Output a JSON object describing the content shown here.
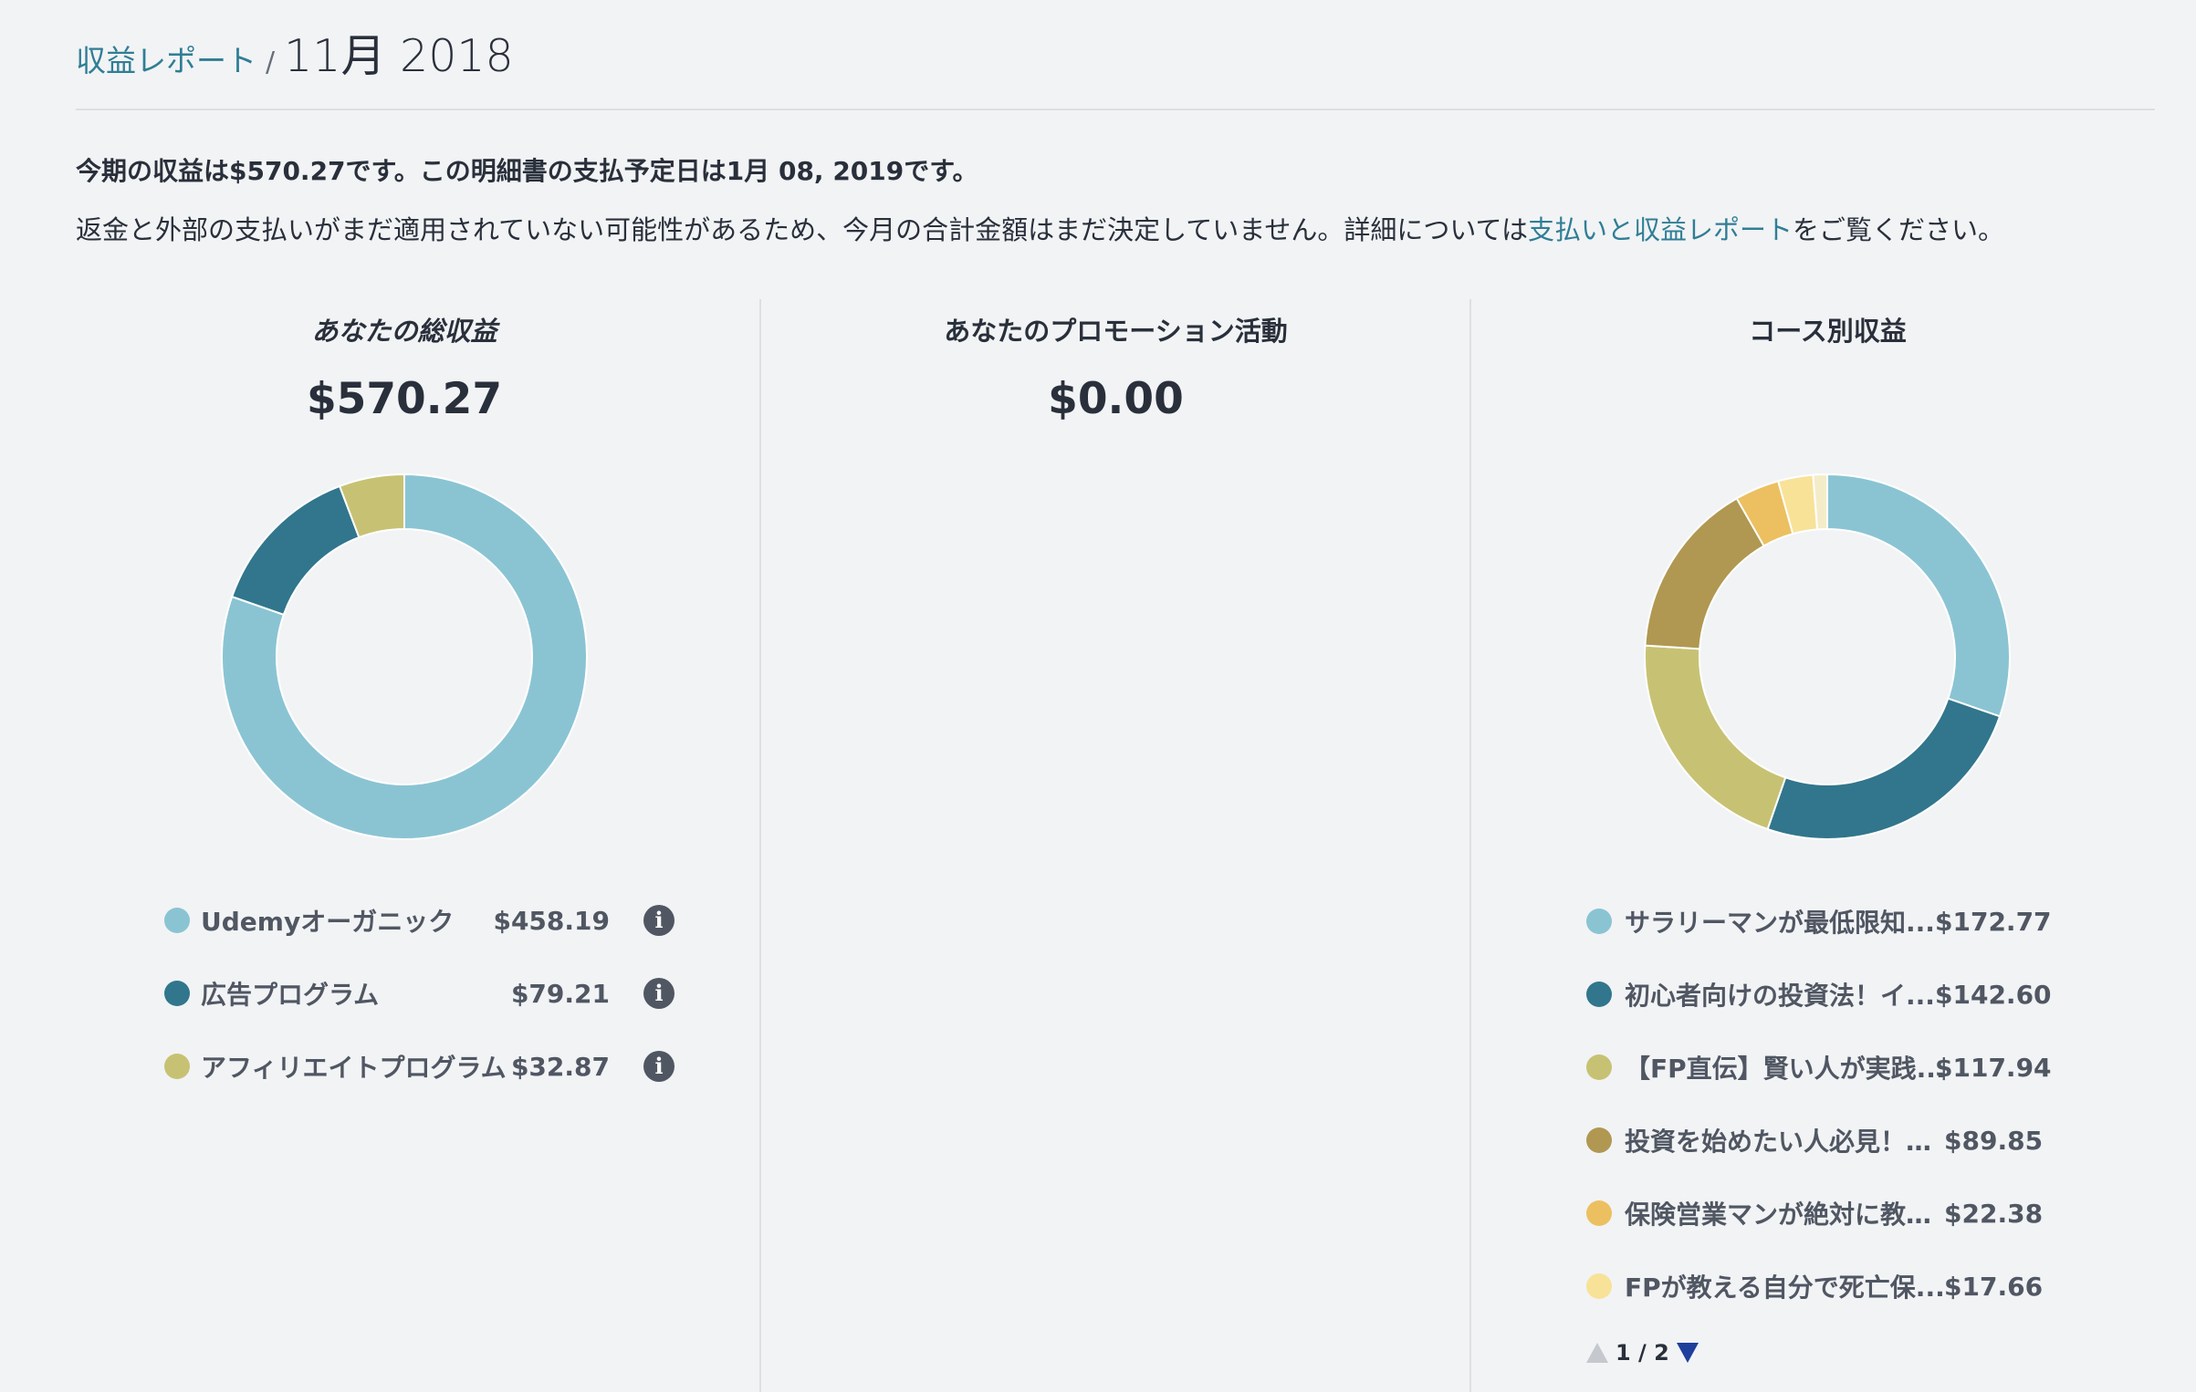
{
  "breadcrumb": {
    "link": "収益レポート",
    "separator": "/",
    "current": "11月 2018"
  },
  "summary_text": "今期の収益は$570.27です。この明細書の支払予定日は1月 08, 2019です。",
  "notice": {
    "before": "返金と外部の支払いがまだ適用されていない可能性があるため、今月の合計金額はまだ決定していません。詳細については",
    "link": "支払いと収益レポート",
    "after": "をご覧ください。"
  },
  "total_revenue": {
    "title": "あなたの総収益",
    "amount": "$570.27",
    "legend": [
      {
        "label": "Udemyオーガニック",
        "value": "$458.19",
        "icon": "info-icon"
      },
      {
        "label": "広告プログラム",
        "value": "$79.21",
        "icon": "info-icon"
      },
      {
        "label": "アフィリエイトプログラム",
        "value": "$32.87",
        "icon": "info-icon"
      }
    ]
  },
  "promotion": {
    "title": "あなたのプロモーション活動",
    "amount": "$0.00"
  },
  "course_revenue": {
    "title": "コース別収益",
    "legend": [
      {
        "label": "サラリーマンが最低限知...",
        "value": "$172.77"
      },
      {
        "label": "初心者向けの投資法！イ...",
        "value": "$142.60"
      },
      {
        "label": "【FP直伝】賢い人が実践...",
        "value": "$117.94"
      },
      {
        "label": "投資を始めたい人必見！支...",
        "value": "$89.85"
      },
      {
        "label": "保険営業マンが絶対に教え...",
        "value": "$22.38"
      },
      {
        "label": "FPが教える自分で死亡保...",
        "value": "$17.66"
      }
    ],
    "pager": "1 / 2"
  },
  "chart_data": [
    {
      "type": "pie",
      "title": "あなたの総収益",
      "categories": [
        "Udemyオーガニック",
        "広告プログラム",
        "アフィリエイトプログラム"
      ],
      "values": [
        458.19,
        79.21,
        32.87
      ],
      "colors": [
        "#8ac4d3",
        "#31768c",
        "#c7c273"
      ]
    },
    {
      "type": "pie",
      "title": "コース別収益",
      "categories": [
        "サラリーマンが最低限知...",
        "初心者向けの投資法！イ...",
        "【FP直伝】賢い人が実践...",
        "投資を始めたい人必見！支...",
        "保険営業マンが絶対に教え...",
        "FPが教える自分で死亡保..."
      ],
      "values": [
        172.77,
        142.6,
        117.94,
        89.85,
        22.38,
        17.66,
        7.07
      ],
      "colors": [
        "#8ac4d3",
        "#31768c",
        "#c7c273",
        "#b09852",
        "#ecc061",
        "#f8e298",
        "#f4ecc9"
      ]
    }
  ],
  "colors": {
    "link": "#2f7e95",
    "text": "#29303b",
    "background": "#f2f3f5"
  }
}
